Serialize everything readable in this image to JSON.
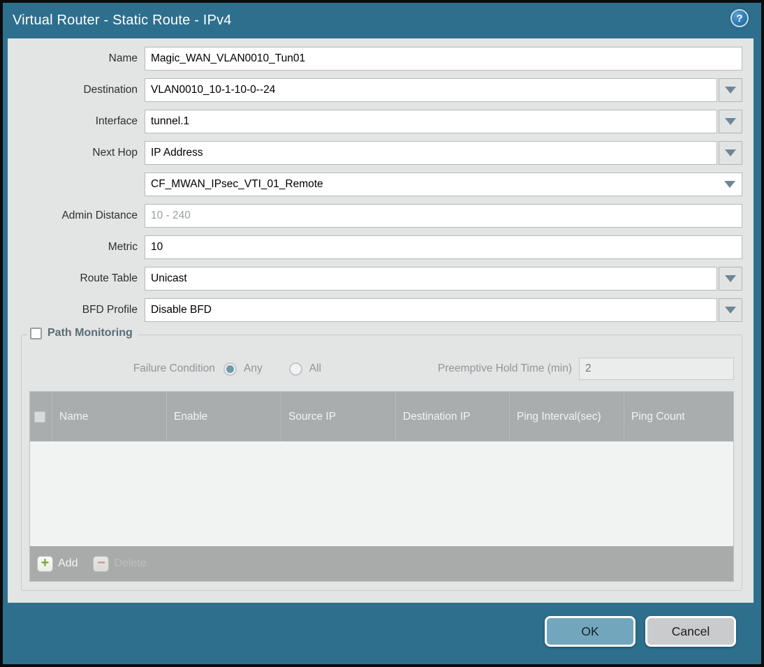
{
  "window": {
    "title": "Virtual Router - Static Route - IPv4",
    "help_glyph": "?"
  },
  "form": {
    "name": {
      "label": "Name",
      "value": "Magic_WAN_VLAN0010_Tun01"
    },
    "destination": {
      "label": "Destination",
      "value": "VLAN0010_10-1-10-0--24"
    },
    "interface": {
      "label": "Interface",
      "value": "tunnel.1"
    },
    "next_hop": {
      "label": "Next Hop",
      "value": "IP Address"
    },
    "next_hop_address": {
      "value": "CF_MWAN_IPsec_VTI_01_Remote"
    },
    "admin_distance": {
      "label": "Admin Distance",
      "placeholder": "10 - 240"
    },
    "metric": {
      "label": "Metric",
      "value": "10"
    },
    "route_table": {
      "label": "Route Table",
      "value": "Unicast"
    },
    "bfd_profile": {
      "label": "BFD Profile",
      "value": "Disable BFD"
    }
  },
  "path_monitoring": {
    "title": "Path Monitoring",
    "enabled": false,
    "failure_condition_label": "Failure Condition",
    "options": [
      {
        "label": "Any",
        "selected": true
      },
      {
        "label": "All",
        "selected": false
      }
    ],
    "hold_time_label": "Preemptive Hold Time (min)",
    "hold_time_value": "2",
    "table": {
      "columns": [
        "Name",
        "Enable",
        "Source IP",
        "Destination IP",
        "Ping Interval(sec)",
        "Ping Count"
      ],
      "rows": []
    },
    "add_label": "Add",
    "delete_label": "Delete",
    "plus_glyph": "+",
    "minus_glyph": "−"
  },
  "actions": {
    "ok": "OK",
    "cancel": "Cancel"
  },
  "colors": {
    "titlebar": "#2e6f8e",
    "panel": "#e3e4e4",
    "table_header": "#a9adad",
    "ok_button": "#72a6bc",
    "cancel_button": "#c9cbcd",
    "add_icon_green": "#7ba32e",
    "delete_icon_red": "#cf8b8b"
  }
}
